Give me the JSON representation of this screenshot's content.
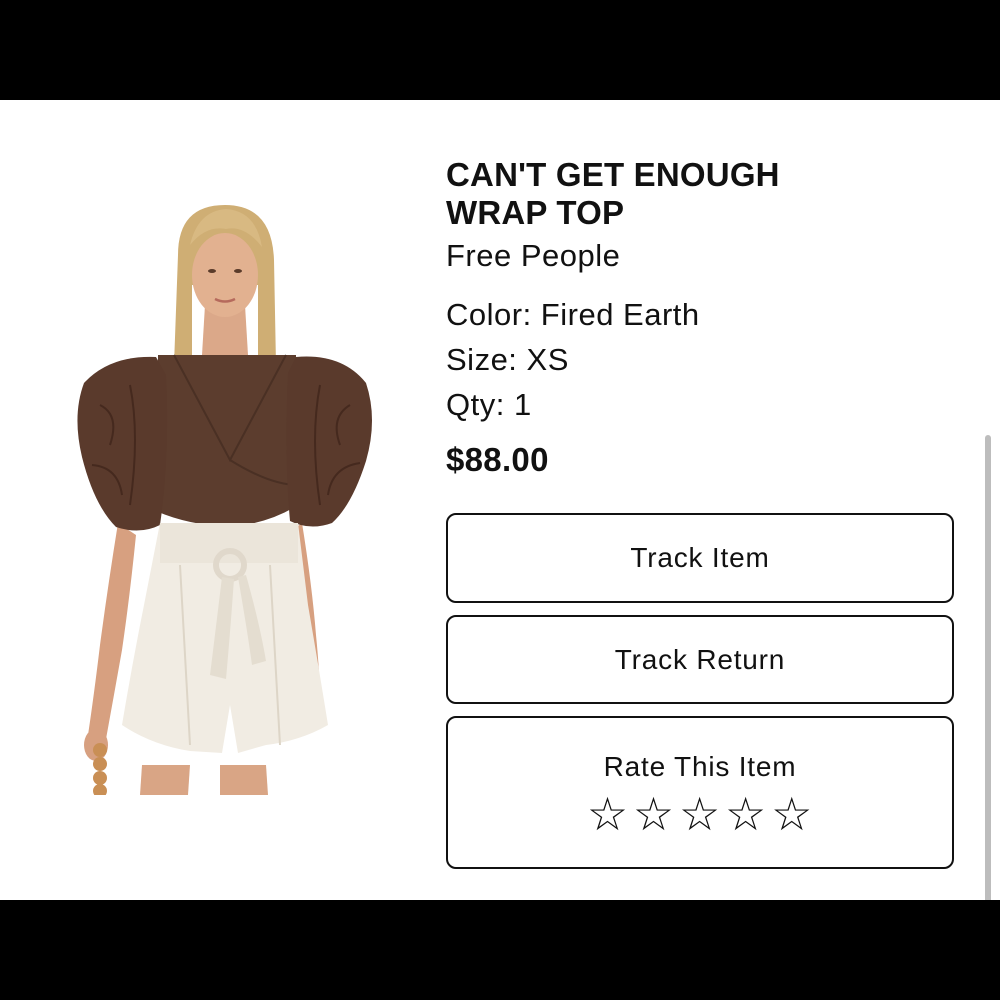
{
  "product": {
    "title_line1": "CAN'T GET ENOUGH",
    "title_line2": "WRAP TOP",
    "brand": "Free People",
    "color_label": "Color: Fired Earth",
    "size_label": "Size: XS",
    "qty_label": "Qty: 1",
    "price": "$88.00",
    "image_alt": "Model wearing a brown puff-sleeve wrap top with cream paperbag shorts"
  },
  "actions": {
    "track_item": "Track Item",
    "track_return": "Track Return",
    "rate_item": "Rate This Item"
  },
  "rating": {
    "stars": [
      "☆",
      "☆",
      "☆",
      "☆",
      "☆"
    ],
    "value": 0,
    "max": 5
  },
  "colors": {
    "top_brown": "#5c3d2e",
    "shorts_cream": "#f1ece3",
    "text": "#111111",
    "background": "#ffffff"
  }
}
